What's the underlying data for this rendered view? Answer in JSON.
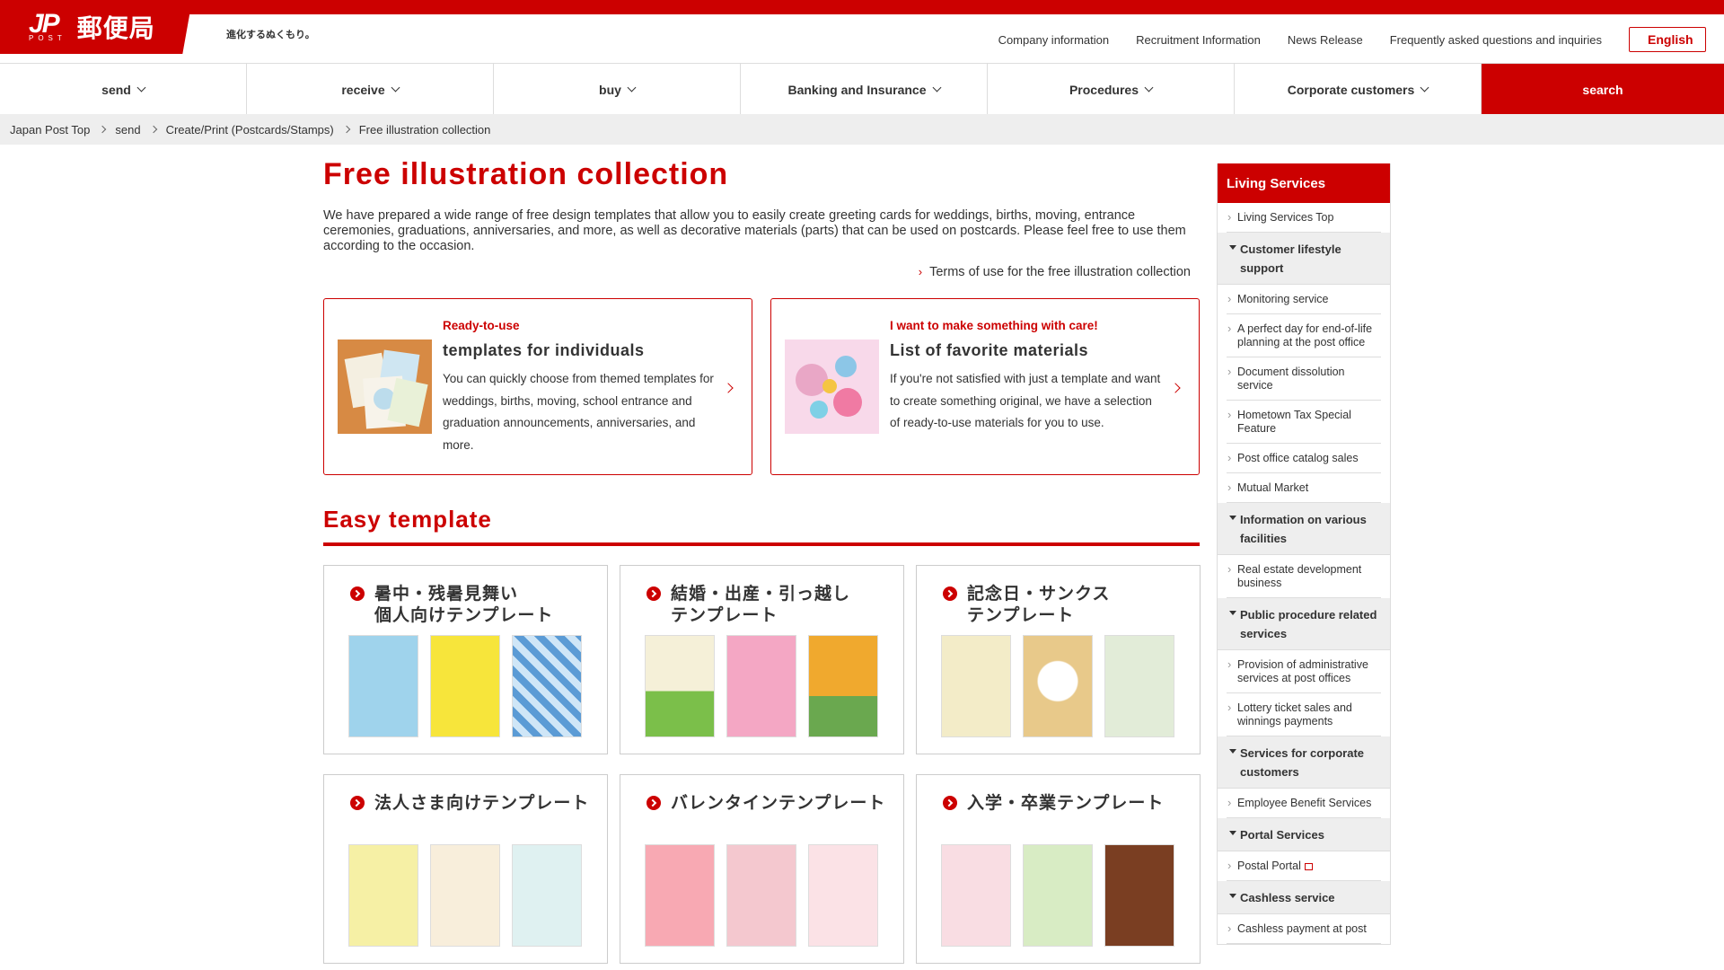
{
  "header": {
    "logo_jp": "JP",
    "logo_post": "POST",
    "logo_kanji": "郵便局",
    "tagline": "進化するぬくもり。",
    "util_links": [
      "Company information",
      "Recruitment Information",
      "News Release",
      "Frequently asked questions and inquiries"
    ],
    "english_label": "English"
  },
  "gnav": {
    "items": [
      "send",
      "receive",
      "buy",
      "Banking and Insurance",
      "Procedures",
      "Corporate customers"
    ],
    "search_label": "search"
  },
  "breadcrumb": [
    "Japan Post Top",
    "send",
    "Create/Print (Postcards/Stamps)",
    "Free illustration collection"
  ],
  "main": {
    "title": "Free illustration collection",
    "intro": "We have prepared a wide range of free design templates that allow you to easily create greeting cards for weddings, births, moving, entrance ceremonies, graduations, anniversaries, and more, as well as decorative materials (parts) that can be used on postcards. Please feel free to use them according to the occasion.",
    "terms_link": "Terms of use for the free illustration collection",
    "cards": [
      {
        "eyebrow": "Ready-to-use",
        "title": "templates for individuals",
        "text": "You can quickly choose from themed templates for weddings, births, moving, school entrance and graduation announcements, anniversaries, and more."
      },
      {
        "eyebrow": "I want to make something with care!",
        "title": "List of favorite materials",
        "text": "If you're not satisfied with just a template and want to create something original, we have a selection of ready-to-use materials for you to use."
      }
    ],
    "section_title": "Easy template",
    "templates": [
      {
        "title": "暑中・残暑見舞い\n個人向けテンプレート",
        "colors": [
          "#9fd3ec",
          "#f7e53b",
          "#5b9bd5"
        ]
      },
      {
        "title": "結婚・出産・引っ越し\nテンプレート",
        "colors": [
          "#7bbf4a",
          "#f4a7c4",
          "#f0a92e"
        ]
      },
      {
        "title": "記念日・サンクス\nテンプレート",
        "colors": [
          "#f3ecc8",
          "#e8c98a",
          "#e2ecd8"
        ]
      },
      {
        "title": "法人さま向けテンプレート",
        "colors": [
          "#f6f0a5",
          "#f8eedb",
          "#dff1f1"
        ]
      },
      {
        "title": "バレンタインテンプレート",
        "colors": [
          "#f8a9b3",
          "#f4c8cf",
          "#fbe2e6"
        ]
      },
      {
        "title": "入学・卒業テンプレート",
        "colors": [
          "#f9dde3",
          "#d8ecc4",
          "#7a3e22"
        ]
      }
    ]
  },
  "sidebar": {
    "heading": "Living Services",
    "entries": [
      {
        "type": "item",
        "label": "Living Services Top"
      },
      {
        "type": "section",
        "label": "Customer lifestyle support"
      },
      {
        "type": "item",
        "label": "Monitoring service"
      },
      {
        "type": "item",
        "label": "A perfect day for end-of-life planning at the post office"
      },
      {
        "type": "item",
        "label": "Document dissolution service"
      },
      {
        "type": "item",
        "label": "Hometown Tax Special Feature"
      },
      {
        "type": "item",
        "label": "Post office catalog sales"
      },
      {
        "type": "item",
        "label": "Mutual Market"
      },
      {
        "type": "section",
        "label": "Information on various facilities"
      },
      {
        "type": "item",
        "label": "Real estate development business"
      },
      {
        "type": "section",
        "label": "Public procedure related services"
      },
      {
        "type": "item",
        "label": "Provision of administrative services at post offices"
      },
      {
        "type": "item",
        "label": "Lottery ticket sales and winnings payments"
      },
      {
        "type": "section",
        "label": "Services for corporate customers"
      },
      {
        "type": "item",
        "label": "Employee Benefit Services"
      },
      {
        "type": "section",
        "label": "Portal Services"
      },
      {
        "type": "item",
        "label": "Postal Portal",
        "external": true
      },
      {
        "type": "section",
        "label": "Cashless service"
      },
      {
        "type": "item",
        "label": "Cashless payment at post"
      }
    ]
  },
  "colors": {
    "brand": "#cc0000",
    "crumb_bg": "#eeeeee"
  }
}
